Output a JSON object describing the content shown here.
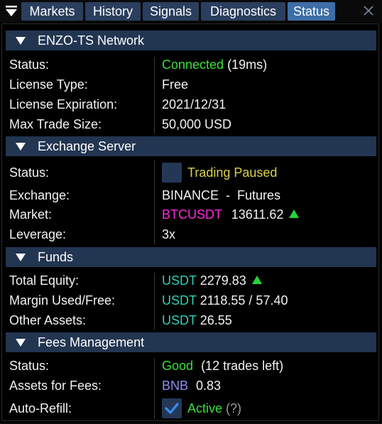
{
  "tabs": [
    {
      "label": "Markets",
      "active": false
    },
    {
      "label": "History",
      "active": false
    },
    {
      "label": "Signals",
      "active": false
    },
    {
      "label": "Diagnostics",
      "active": false
    },
    {
      "label": "Status",
      "active": true
    }
  ],
  "icons": {
    "menu": "menu-filter-icon",
    "close": "close-icon",
    "collapse": "triangle-down-icon",
    "trend_up": "triangle-up-icon",
    "check": "checkmark-icon"
  },
  "colors": {
    "accent_tab": "#3d6ea6",
    "tab": "#2a3e5e",
    "section": "#223551",
    "connected": "#38e038",
    "paused": "#d9d24a",
    "symbol": "#ff2bd9",
    "currency": "#2fd1b6",
    "fee_asset": "#8c8ef0"
  },
  "sections": {
    "network": {
      "title": "ENZO-TS Network",
      "status_label": "Status:",
      "status_value": "Connected",
      "status_latency": "(19ms)",
      "license_type_label": "License Type:",
      "license_type_value": "Free",
      "license_exp_label": "License Expiration:",
      "license_exp_value": "2021/12/31",
      "max_trade_label": "Max Trade Size:",
      "max_trade_value": "50,000 USD"
    },
    "exchange": {
      "title": "Exchange Server",
      "status_label": "Status:",
      "status_value": "Trading Paused",
      "exchange_label": "Exchange:",
      "exchange_value": "BINANCE  -  Futures",
      "market_label": "Market:",
      "market_symbol": "BTCUSDT",
      "market_price": "13611.62",
      "leverage_label": "Leverage:",
      "leverage_value": "3x"
    },
    "funds": {
      "title": "Funds",
      "equity_label": "Total Equity:",
      "equity_currency": "USDT",
      "equity_value": "2279.83",
      "margin_label": "Margin Used/Free:",
      "margin_currency": "USDT",
      "margin_value": "2118.55 / 57.40",
      "other_label": "Other Assets:",
      "other_currency": "USDT",
      "other_value": "26.55"
    },
    "fees": {
      "title": "Fees Management",
      "status_label": "Status:",
      "status_value": "Good",
      "status_detail": "(12 trades left)",
      "assets_label": "Assets for Fees:",
      "assets_currency": "BNB",
      "assets_value": "0.83",
      "refill_label": "Auto-Refill:",
      "refill_checked": true,
      "refill_value": "Active",
      "refill_help": "(?)"
    }
  }
}
